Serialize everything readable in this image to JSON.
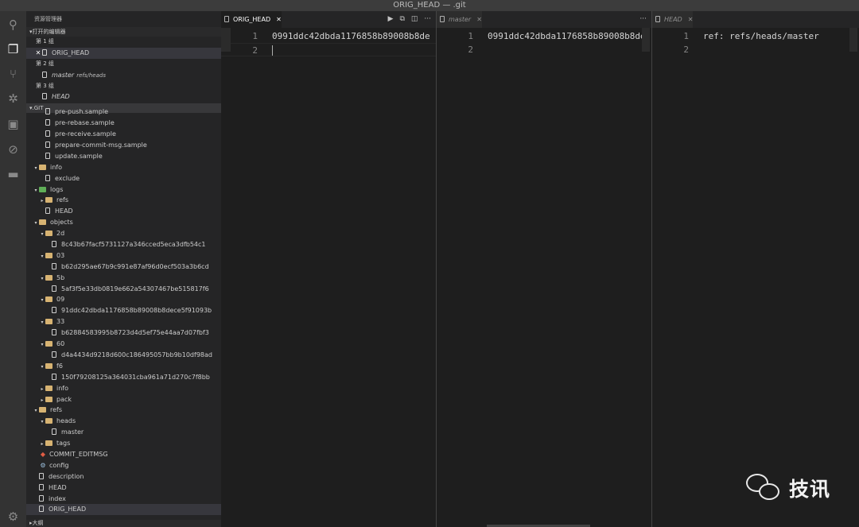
{
  "window": {
    "title": "ORIG_HEAD — .git"
  },
  "activity_bar": [
    "search-icon",
    "files-icon",
    "source-control-icon",
    "debug-icon",
    "extensions-icon",
    "git-icon",
    "folder-icon",
    "gear-icon"
  ],
  "sidebar": {
    "title": "资源管理器",
    "open_editors": {
      "header": "打开的编辑器",
      "groups": [
        {
          "label": "第 1 组",
          "items": [
            {
              "name": "ORIG_HEAD",
              "sub": "",
              "selected": true,
              "closable": true,
              "italic": false
            }
          ]
        },
        {
          "label": "第 2 组",
          "items": [
            {
              "name": "master",
              "sub": "refs/heads",
              "selected": false,
              "closable": false,
              "italic": true
            }
          ]
        },
        {
          "label": "第 3 组",
          "items": [
            {
              "name": "HEAD",
              "sub": "",
              "selected": false,
              "closable": false,
              "italic": true
            }
          ]
        }
      ]
    },
    "explorer": {
      "header": ".GIT",
      "tree": [
        {
          "name": "pre-push.sample",
          "kind": "file",
          "depth": 2
        },
        {
          "name": "pre-rebase.sample",
          "kind": "file",
          "depth": 2
        },
        {
          "name": "pre-receive.sample",
          "kind": "file",
          "depth": 2
        },
        {
          "name": "prepare-commit-msg.sample",
          "kind": "file",
          "depth": 2
        },
        {
          "name": "update.sample",
          "kind": "file",
          "depth": 2
        },
        {
          "name": "info",
          "kind": "folder-open",
          "depth": 1
        },
        {
          "name": "exclude",
          "kind": "file",
          "depth": 2
        },
        {
          "name": "logs",
          "kind": "folder-open-green",
          "depth": 1
        },
        {
          "name": "refs",
          "kind": "folder-closed",
          "depth": 2
        },
        {
          "name": "HEAD",
          "kind": "file",
          "depth": 2
        },
        {
          "name": "objects",
          "kind": "folder-open",
          "depth": 1
        },
        {
          "name": "2d",
          "kind": "folder-open",
          "depth": 2
        },
        {
          "name": "8c43b67facf5731127a346cced5eca3dfb54c1",
          "kind": "file",
          "depth": 3
        },
        {
          "name": "03",
          "kind": "folder-open",
          "depth": 2
        },
        {
          "name": "b62d295ae67b9c991e87af96d0ecf503a3b6cd",
          "kind": "file",
          "depth": 3
        },
        {
          "name": "5b",
          "kind": "folder-open",
          "depth": 2
        },
        {
          "name": "5af3f5e33db0819e662a54307467be515817f6",
          "kind": "file",
          "depth": 3
        },
        {
          "name": "09",
          "kind": "folder-open",
          "depth": 2
        },
        {
          "name": "91ddc42dbda1176858b89008b8dece5f91093b",
          "kind": "file",
          "depth": 3
        },
        {
          "name": "33",
          "kind": "folder-open",
          "depth": 2
        },
        {
          "name": "b62884583995b8723d4d5ef75e44aa7d07fbf3",
          "kind": "file",
          "depth": 3
        },
        {
          "name": "60",
          "kind": "folder-open",
          "depth": 2
        },
        {
          "name": "d4a4434d9218d600c186495057bb9b10df98ad",
          "kind": "file",
          "depth": 3
        },
        {
          "name": "f6",
          "kind": "folder-open",
          "depth": 2
        },
        {
          "name": "150f79208125a364031cba961a71d270c7f8bb",
          "kind": "file",
          "depth": 3
        },
        {
          "name": "info",
          "kind": "folder-closed",
          "depth": 2
        },
        {
          "name": "pack",
          "kind": "folder-closed",
          "depth": 2
        },
        {
          "name": "refs",
          "kind": "folder-open",
          "depth": 1
        },
        {
          "name": "heads",
          "kind": "folder-open",
          "depth": 2
        },
        {
          "name": "master",
          "kind": "file",
          "depth": 3
        },
        {
          "name": "tags",
          "kind": "folder-closed",
          "depth": 2
        },
        {
          "name": "COMMIT_EDITMSG",
          "kind": "git-file",
          "depth": 1
        },
        {
          "name": "config",
          "kind": "gear-file",
          "depth": 1
        },
        {
          "name": "description",
          "kind": "file",
          "depth": 1
        },
        {
          "name": "HEAD",
          "kind": "file",
          "depth": 1
        },
        {
          "name": "index",
          "kind": "file",
          "depth": 1
        },
        {
          "name": "ORIG_HEAD",
          "kind": "file",
          "depth": 1,
          "selected": true
        }
      ]
    },
    "outline_header": "大纲"
  },
  "editor_groups": [
    {
      "tab": {
        "label": "ORIG_HEAD",
        "active": true
      },
      "actions": [
        "▶",
        "⧉",
        "◫",
        "···"
      ],
      "lines": [
        {
          "n": "1",
          "text": "0991ddc42dbda1176858b89008b8de"
        },
        {
          "n": "2",
          "text": ""
        }
      ]
    },
    {
      "tab": {
        "label": "master",
        "active": false
      },
      "actions": [
        "···"
      ],
      "lines": [
        {
          "n": "1",
          "text": "0991ddc42dbda1176858b89008b8de"
        },
        {
          "n": "2",
          "text": ""
        }
      ]
    },
    {
      "tab": {
        "label": "HEAD",
        "active": false
      },
      "actions": [],
      "lines": [
        {
          "n": "1",
          "text": "ref: refs/heads/master"
        },
        {
          "n": "2",
          "text": ""
        }
      ]
    }
  ],
  "watermark": {
    "text": "技讯"
  }
}
